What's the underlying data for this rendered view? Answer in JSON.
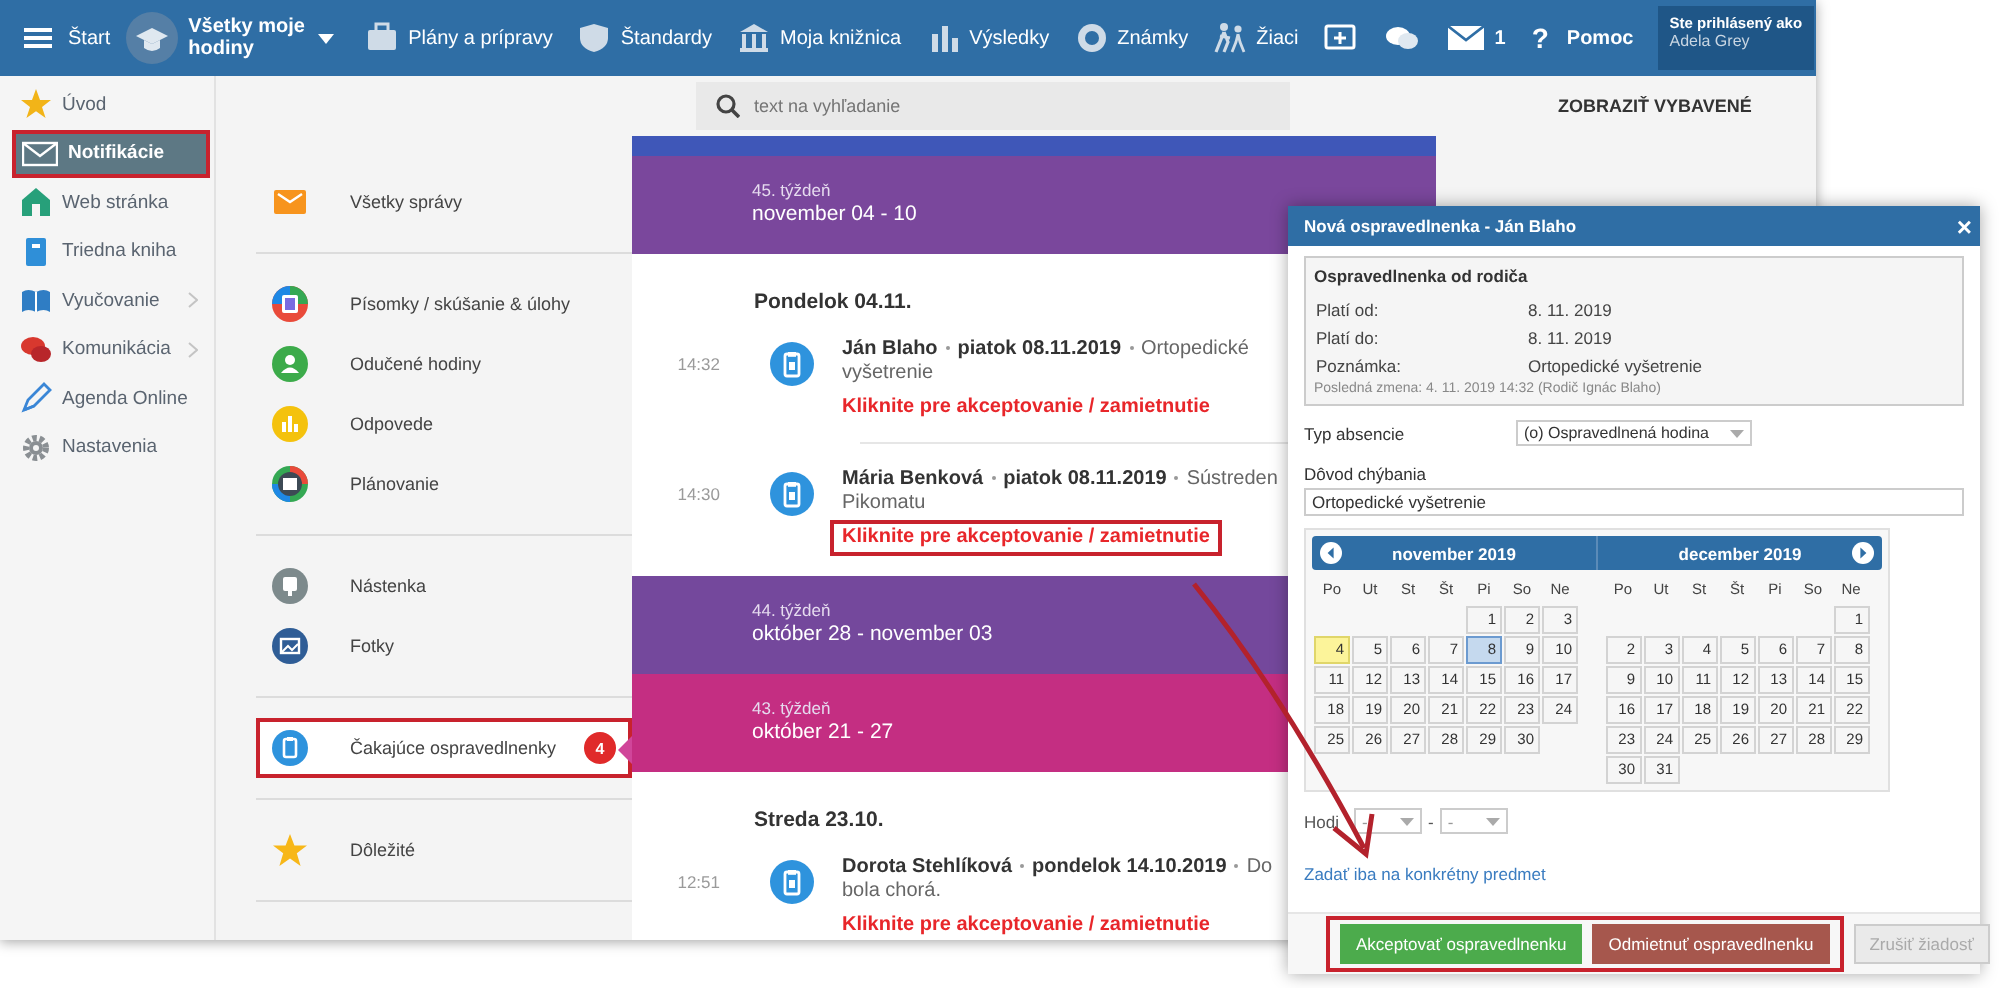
{
  "topbar": {
    "start": "Štart",
    "course": "Všetky moje hodiny",
    "nav": [
      "Plány a prípravy",
      "Štandardy",
      "Moja knižnica",
      "Výsledky",
      "Známky",
      "Žiaci"
    ],
    "messages_count": "1",
    "help": {
      "glyph": "?",
      "label": "Pomoc"
    },
    "login": {
      "caption": "Ste prihlásený ako",
      "user": "Adela Grey"
    }
  },
  "sidebar": {
    "items": [
      {
        "label": "Úvod",
        "selected": false,
        "highlighted": false,
        "expandable": false
      },
      {
        "label": "Notifikácie",
        "selected": true,
        "highlighted": true,
        "expandable": false
      },
      {
        "label": "Web stránka",
        "selected": false,
        "highlighted": false,
        "expandable": false
      },
      {
        "label": "Triedna kniha",
        "selected": false,
        "highlighted": false,
        "expandable": false
      },
      {
        "label": "Vyučovanie",
        "selected": false,
        "highlighted": false,
        "expandable": true
      },
      {
        "label": "Komunikácia",
        "selected": false,
        "highlighted": false,
        "expandable": true
      },
      {
        "label": "Agenda Online",
        "selected": false,
        "highlighted": false,
        "expandable": false
      },
      {
        "label": "Nastavenia",
        "selected": false,
        "highlighted": false,
        "expandable": false
      }
    ]
  },
  "search": {
    "placeholder": "text na vyhľadanie"
  },
  "show_done": "ZOBRAZIŤ VYBAVENÉ",
  "categories": [
    [
      {
        "label": "Všetky správy",
        "selected": false,
        "highlighted": false
      }
    ],
    [
      {
        "label": "Písomky / skúšanie & úlohy",
        "selected": false,
        "highlighted": false
      },
      {
        "label": "Odučené hodiny",
        "selected": false,
        "highlighted": false
      },
      {
        "label": "Odpovede",
        "selected": false,
        "highlighted": false
      },
      {
        "label": "Plánovanie",
        "selected": false,
        "highlighted": false
      }
    ],
    [
      {
        "label": "Nástenka",
        "selected": false,
        "highlighted": false
      },
      {
        "label": "Fotky",
        "selected": false,
        "highlighted": false
      }
    ],
    [
      {
        "label": "Čakajúce ospravedlnenky",
        "selected": true,
        "highlighted": true,
        "badge": "4"
      }
    ],
    [
      {
        "label": "Dôležité",
        "selected": false,
        "highlighted": false
      }
    ]
  ],
  "feed": [
    {
      "kind": "week",
      "color": "#3f57b8"
    },
    {
      "kind": "week",
      "color": "#7a479c",
      "week": "45. týždeň",
      "range": "november 04 - 10"
    },
    {
      "kind": "day",
      "label": "Pondelok 04.11."
    },
    {
      "kind": "entry",
      "time": "14:32",
      "name": "Ján Blaho",
      "date": "piatok 08.11.2019",
      "note_lines": [
        "Ortopedické",
        "vyšetrenie"
      ],
      "action": "Kliknite pre akceptovanie / zamietnutie",
      "highlighted": false
    },
    {
      "kind": "entry",
      "time": "14:30",
      "name": "Mária Benková",
      "date": "piatok 08.11.2019",
      "note_lines": [
        "Sústreden",
        "Pikomatu"
      ],
      "action": "Kliknite pre akceptovanie / zamietnutie",
      "highlighted": true
    },
    {
      "kind": "week",
      "color": "#74489c",
      "week": "44. týždeň",
      "range": "október 28 - november 03"
    },
    {
      "kind": "week",
      "color": "#c42e82",
      "week": "43. týždeň",
      "range": "október 21 - 27"
    },
    {
      "kind": "day",
      "label": "Streda 23.10."
    },
    {
      "kind": "entry",
      "time": "12:51",
      "name": "Dorota Stehlíková",
      "date": "pondelok 14.10.2019",
      "note_lines": [
        "Do",
        "bola chorá."
      ],
      "action": "Kliknite pre akceptovanie / zamietnutie",
      "highlighted": false
    }
  ],
  "dialog": {
    "title": "Nová ospravedlnenka - Ján Blaho",
    "close": "×",
    "info": {
      "title": "Ospravedlnenka od rodiča",
      "rows": [
        {
          "label": "Platí od:",
          "value": "8. 11. 2019"
        },
        {
          "label": "Platí do:",
          "value": "8. 11. 2019"
        },
        {
          "label": "Poznámka:",
          "value": "Ortopedické vyšetrenie"
        }
      ],
      "footnote": "Posledná zmena: 4. 11. 2019 14:32 (Rodič Ignác Blaho)"
    },
    "absence_type": {
      "label": "Typ absencie",
      "value": "(o) Ospravedlnená hodina"
    },
    "reason": {
      "label": "Dôvod chýbania",
      "value": "Ortopedické vyšetrenie"
    },
    "months": [
      {
        "title": "november 2019",
        "weekdays": [
          "Po",
          "Ut",
          "St",
          "Št",
          "Pi",
          "So",
          "Ne"
        ],
        "weeks": [
          [
            {
              "kind": "blank"
            },
            {
              "kind": "blank"
            },
            {
              "kind": "blank"
            },
            {
              "kind": "blank"
            },
            {
              "day": "1",
              "kind": "day"
            },
            {
              "day": "2",
              "kind": "day"
            },
            {
              "day": "3",
              "kind": "day"
            }
          ],
          [
            {
              "day": "4",
              "kind": "today"
            },
            {
              "day": "5",
              "kind": "day"
            },
            {
              "day": "6",
              "kind": "day"
            },
            {
              "day": "7",
              "kind": "day"
            },
            {
              "day": "8",
              "kind": "selected"
            },
            {
              "day": "9",
              "kind": "day"
            },
            {
              "day": "10",
              "kind": "day"
            }
          ],
          [
            {
              "day": "11",
              "kind": "day"
            },
            {
              "day": "12",
              "kind": "day"
            },
            {
              "day": "13",
              "kind": "day"
            },
            {
              "day": "14",
              "kind": "day"
            },
            {
              "day": "15",
              "kind": "day"
            },
            {
              "day": "16",
              "kind": "day"
            },
            {
              "day": "17",
              "kind": "day"
            }
          ],
          [
            {
              "day": "18",
              "kind": "day"
            },
            {
              "day": "19",
              "kind": "day"
            },
            {
              "day": "20",
              "kind": "day"
            },
            {
              "day": "21",
              "kind": "day"
            },
            {
              "day": "22",
              "kind": "day"
            },
            {
              "day": "23",
              "kind": "day"
            },
            {
              "day": "24",
              "kind": "day"
            }
          ],
          [
            {
              "day": "25",
              "kind": "day"
            },
            {
              "day": "26",
              "kind": "day"
            },
            {
              "day": "27",
              "kind": "day"
            },
            {
              "day": "28",
              "kind": "day"
            },
            {
              "day": "29",
              "kind": "day"
            },
            {
              "day": "30",
              "kind": "day"
            },
            {
              "kind": "blank"
            }
          ]
        ]
      },
      {
        "title": "december 2019",
        "weekdays": [
          "Po",
          "Ut",
          "St",
          "Št",
          "Pi",
          "So",
          "Ne"
        ],
        "weeks": [
          [
            {
              "kind": "blank"
            },
            {
              "kind": "blank"
            },
            {
              "kind": "blank"
            },
            {
              "kind": "blank"
            },
            {
              "kind": "blank"
            },
            {
              "kind": "blank"
            },
            {
              "day": "1",
              "kind": "day"
            }
          ],
          [
            {
              "day": "2",
              "kind": "day"
            },
            {
              "day": "3",
              "kind": "day"
            },
            {
              "day": "4",
              "kind": "day"
            },
            {
              "day": "5",
              "kind": "day"
            },
            {
              "day": "6",
              "kind": "day"
            },
            {
              "day": "7",
              "kind": "day"
            },
            {
              "day": "8",
              "kind": "day"
            }
          ],
          [
            {
              "day": "9",
              "kind": "day"
            },
            {
              "day": "10",
              "kind": "day"
            },
            {
              "day": "11",
              "kind": "day"
            },
            {
              "day": "12",
              "kind": "day"
            },
            {
              "day": "13",
              "kind": "day"
            },
            {
              "day": "14",
              "kind": "day"
            },
            {
              "day": "15",
              "kind": "day"
            }
          ],
          [
            {
              "day": "16",
              "kind": "day"
            },
            {
              "day": "17",
              "kind": "day"
            },
            {
              "day": "18",
              "kind": "day"
            },
            {
              "day": "19",
              "kind": "day"
            },
            {
              "day": "20",
              "kind": "day"
            },
            {
              "day": "21",
              "kind": "day"
            },
            {
              "day": "22",
              "kind": "day"
            }
          ],
          [
            {
              "day": "23",
              "kind": "day"
            },
            {
              "day": "24",
              "kind": "day"
            },
            {
              "day": "25",
              "kind": "day"
            },
            {
              "day": "26",
              "kind": "day"
            },
            {
              "day": "27",
              "kind": "day"
            },
            {
              "day": "28",
              "kind": "day"
            },
            {
              "day": "29",
              "kind": "day"
            }
          ],
          [
            {
              "day": "30",
              "kind": "day"
            },
            {
              "day": "31",
              "kind": "day"
            }
          ]
        ]
      }
    ],
    "hours": {
      "label": "Hodi",
      "from": "-",
      "separator": "-",
      "to": "-"
    },
    "subject_link": "Zadať iba na konkrétny predmet",
    "buttons_highlighted": true,
    "buttons": [
      {
        "label": "Akceptovať ospravedlnenku",
        "kind": "accept",
        "disabled": false
      },
      {
        "label": "Odmietnuť ospravedlnenku",
        "kind": "reject",
        "disabled": false
      },
      {
        "label": "Zrušiť žiadosť",
        "kind": "cancel",
        "disabled": true
      }
    ]
  },
  "annotation_arrow": true
}
